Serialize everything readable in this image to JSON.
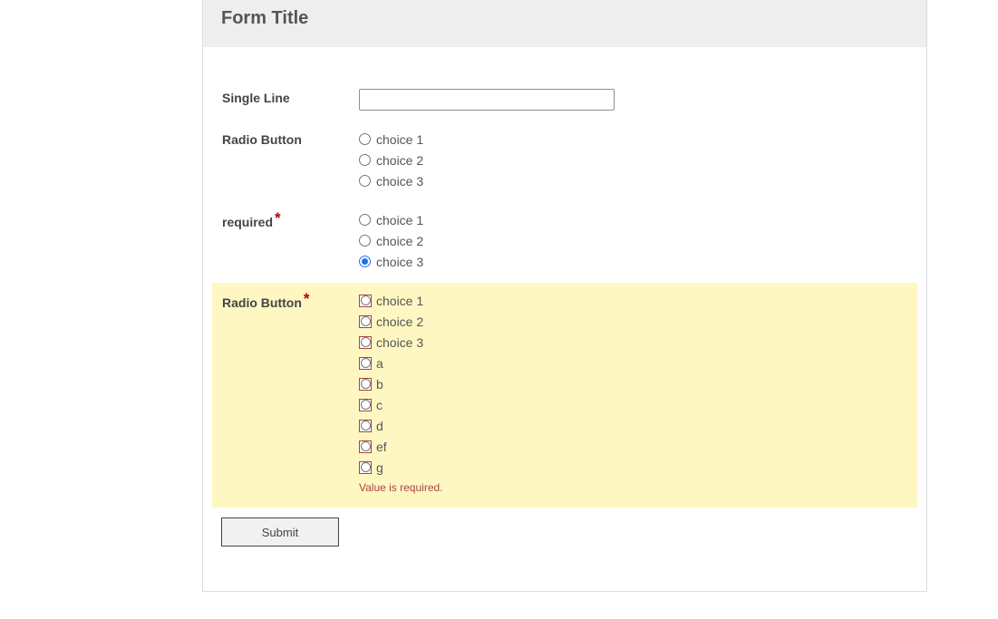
{
  "form": {
    "title": "Form Title"
  },
  "fields": {
    "single_line": {
      "label": "Single Line",
      "value": ""
    },
    "radio1": {
      "label": "Radio Button",
      "options": [
        "choice 1",
        "choice 2",
        "choice 3"
      ],
      "selected": null
    },
    "radio_required": {
      "label": "required",
      "required_mark": "*",
      "options": [
        "choice 1",
        "choice 2",
        "choice 3"
      ],
      "selected": "choice 3"
    },
    "radio2": {
      "label": "Radio Button",
      "required_mark": "*",
      "options": [
        "choice 1",
        "choice 2",
        "choice 3",
        "a",
        "b",
        "c",
        "d",
        "ef",
        "g"
      ],
      "selected": null,
      "error": "Value is required."
    }
  },
  "actions": {
    "submit_label": "Submit"
  },
  "colors": {
    "header_bg": "#eeeeee",
    "error_bg": "#fff7c2",
    "error_text": "#a94442",
    "required_star": "#b20000",
    "radio_checked": "#1a73e8"
  }
}
